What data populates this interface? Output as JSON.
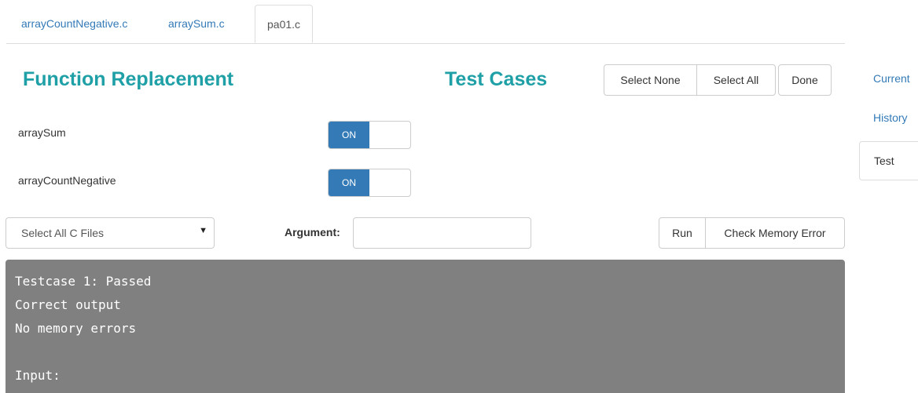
{
  "file_tabs": [
    {
      "label": "arrayCountNegative.c",
      "active": false
    },
    {
      "label": "arraySum.c",
      "active": false
    },
    {
      "label": "pa01.c",
      "active": true
    }
  ],
  "headings": {
    "function_replacement": "Function Replacement",
    "test_cases": "Test Cases"
  },
  "test_case_buttons": {
    "select_none": "Select None",
    "select_all": "Select All",
    "done": "Done"
  },
  "functions": [
    {
      "name": "arraySum",
      "toggle": "ON"
    },
    {
      "name": "arrayCountNegative",
      "toggle": "ON"
    }
  ],
  "controls": {
    "file_select": "Select All C Files",
    "argument_label": "Argument:",
    "argument_value": "",
    "run": "Run",
    "check_memory": "Check Memory Error"
  },
  "output_lines": [
    "Testcase 1: Passed",
    "Correct output",
    "No memory errors",
    "",
    "Input:"
  ],
  "side_nav": [
    {
      "label": "Current",
      "active": false
    },
    {
      "label": "History",
      "active": false
    },
    {
      "label": "Test",
      "active": true
    }
  ],
  "colors": {
    "accent_heading": "#1fa0a6",
    "link": "#337ab7",
    "toggle_on": "#337ab7",
    "output_bg": "#808080"
  }
}
